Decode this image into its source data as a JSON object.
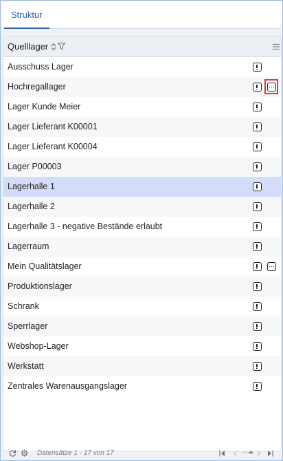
{
  "tabs": [
    {
      "label": "Struktur",
      "active": true
    }
  ],
  "grid": {
    "column_header": "Quelllager",
    "rows": [
      {
        "label": "Ausschuss Lager",
        "more": false,
        "selected": false
      },
      {
        "label": "Hochregallager",
        "more": true,
        "selected": false,
        "highlighted": true
      },
      {
        "label": "Lager Kunde Meier",
        "more": false,
        "selected": false
      },
      {
        "label": "Lager Lieferant K00001",
        "more": false,
        "selected": false
      },
      {
        "label": "Lager Lieferant K00004",
        "more": false,
        "selected": false
      },
      {
        "label": "Lager P00003",
        "more": false,
        "selected": false
      },
      {
        "label": "Lagerhalle 1",
        "more": false,
        "selected": true
      },
      {
        "label": "Lagerhalle 2",
        "more": false,
        "selected": false
      },
      {
        "label": "Lagerhalle 3 - negative Bestände erlaubt",
        "more": false,
        "selected": false
      },
      {
        "label": "Lagerraum",
        "more": false,
        "selected": false
      },
      {
        "label": "Mein Qualitätslager",
        "more": true,
        "selected": false
      },
      {
        "label": "Produktionslager",
        "more": false,
        "selected": false
      },
      {
        "label": "Schrank",
        "more": false,
        "selected": false
      },
      {
        "label": "Sperrlager",
        "more": false,
        "selected": false
      },
      {
        "label": "Webshop-Lager",
        "more": false,
        "selected": false
      },
      {
        "label": "Werkstatt",
        "more": false,
        "selected": false
      },
      {
        "label": "Zentrales Warenausgangslager",
        "more": false,
        "selected": false
      }
    ]
  },
  "footer": {
    "status": "Datensätze 1 - 17 von 17",
    "pager_ellipsis": "···"
  },
  "colors": {
    "accent": "#2c5fa8",
    "selected_row": "#d3dcf8",
    "highlight": "#e03a3a"
  },
  "icons": {
    "sort": "sort-icon",
    "filter": "filter-icon",
    "menu": "column-menu-icon",
    "info": "info-icon",
    "more": "more-icon",
    "refresh": "refresh-icon",
    "settings": "gear-icon"
  }
}
